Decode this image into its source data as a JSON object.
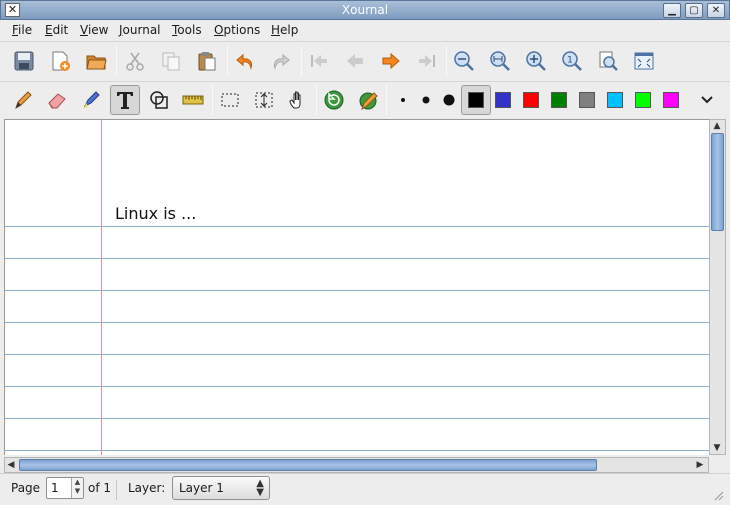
{
  "window": {
    "title": "Xournal"
  },
  "menu": [
    {
      "label": "File",
      "key": "F",
      "rest": "ile"
    },
    {
      "label": "Edit",
      "key": "E",
      "rest": "dit"
    },
    {
      "label": "View",
      "key": "V",
      "rest": "iew"
    },
    {
      "label": "Journal",
      "key": "J",
      "rest": "ournal"
    },
    {
      "label": "Tools",
      "key": "T",
      "rest": "ools"
    },
    {
      "label": "Options",
      "key": "O",
      "rest": "ptions"
    },
    {
      "label": "Help",
      "key": "H",
      "rest": "elp"
    }
  ],
  "toolbar_main": [
    "save-icon",
    "new-page-icon",
    "open-icon",
    "cut-icon",
    "copy-icon",
    "paste-icon",
    "undo-icon",
    "redo-icon",
    "first-page-icon",
    "previous-page-icon",
    "next-page-icon",
    "last-page-icon",
    "zoom-out-icon",
    "zoom-fit-width-icon",
    "zoom-in-icon",
    "zoom-100-icon",
    "zoom-page-icon",
    "fullscreen-icon"
  ],
  "toolbar_tools": [
    "pen-icon",
    "eraser-icon",
    "highlighter-icon",
    "text-tool-icon",
    "shape-recognizer-icon",
    "ruler-icon",
    "select-rectangle-icon",
    "vertical-space-icon",
    "hand-icon",
    "default-tool-icon",
    "default-pen-icon"
  ],
  "colors": {
    "black": "#000000",
    "blue": "#3333cc",
    "red": "#ff0000",
    "green": "#008000",
    "gray": "#808080",
    "light_blue": "#00c0ff",
    "light_green": "#00ff00",
    "magenta": "#ff00ff",
    "selected": "black"
  },
  "page": {
    "text": "Linux is ..."
  },
  "status": {
    "page_label": "Page",
    "page_value": "1",
    "page_of": "of 1",
    "layer_label": "Layer:",
    "layer_value": "Layer 1"
  }
}
